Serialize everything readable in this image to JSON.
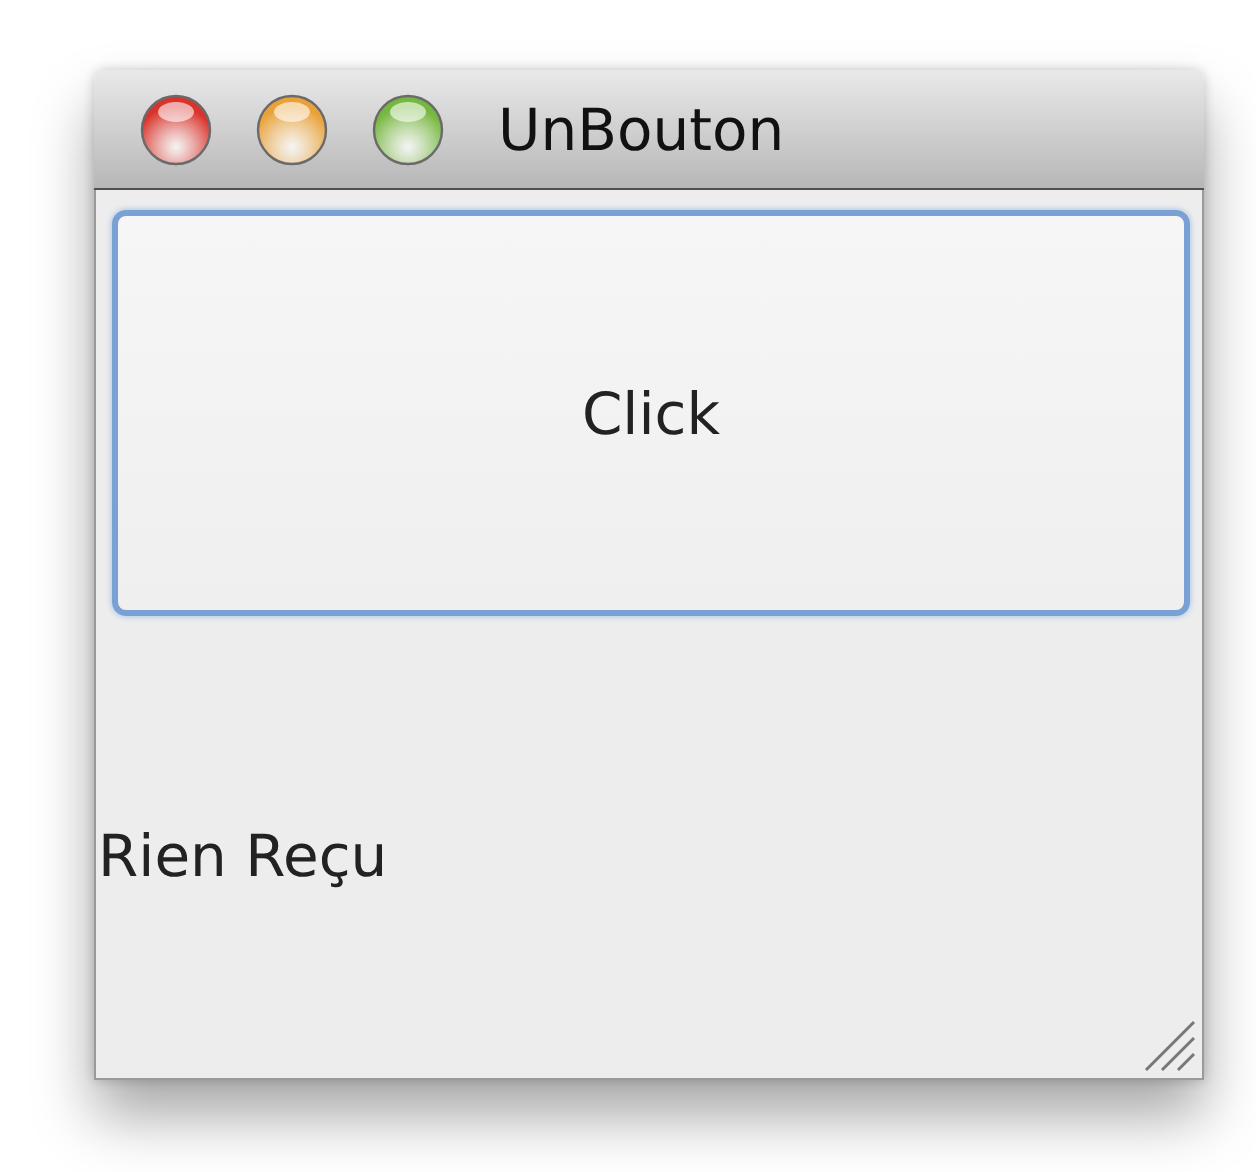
{
  "window": {
    "title": "UnBouton"
  },
  "button": {
    "label": "Click",
    "focused": true
  },
  "status_label": "Rien Reçu"
}
